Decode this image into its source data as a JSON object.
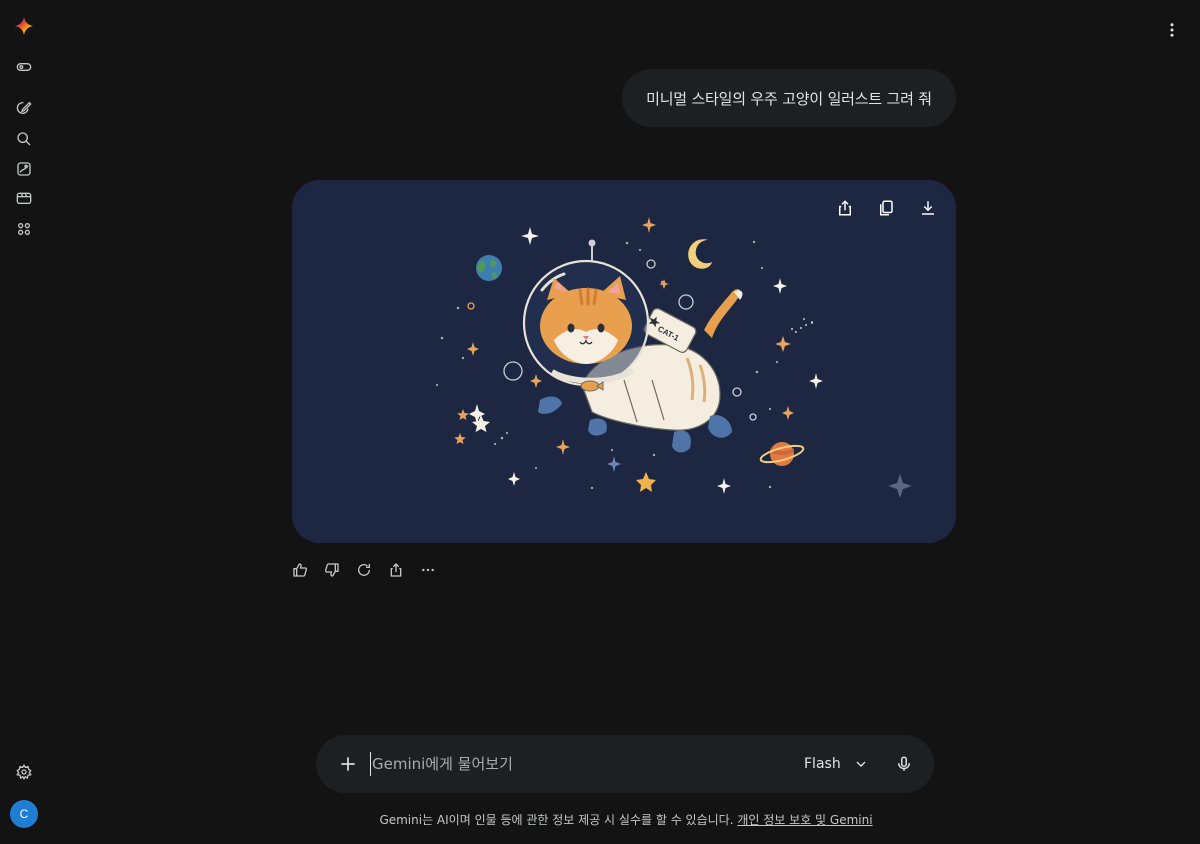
{
  "app": {
    "name": "Gemini",
    "accent_colors": [
      "#4285f4",
      "#ea4335",
      "#fbbc04",
      "#34a853"
    ]
  },
  "sidebar": {
    "items": [
      {
        "icon": "gemini-logo-icon"
      },
      {
        "icon": "toggle-sidebar-icon"
      },
      {
        "icon": "new-chat-icon"
      },
      {
        "icon": "search-icon"
      },
      {
        "icon": "gallery-icon"
      },
      {
        "icon": "video-icon"
      },
      {
        "icon": "apps-grid-icon"
      }
    ],
    "settings_icon": "gear-icon",
    "avatar_initial": "C",
    "avatar_color": "#1f7ed4"
  },
  "conversation": {
    "user_message": "미니멀 스타일의 우주 고양이 일러스트 그려 줘",
    "image_badge": "CAT-1",
    "image_actions": [
      "share-icon",
      "copy-icon",
      "download-icon"
    ],
    "reply_actions": [
      "thumbs-up-icon",
      "thumbs-down-icon",
      "regenerate-icon",
      "share-icon",
      "more-icon"
    ]
  },
  "composer": {
    "placeholder": "Gemini에게 물어보기",
    "model": "Flash"
  },
  "footer": {
    "disclaimer": "Gemini는 AI이며 인물 등에 관한 정보 제공 시 실수를 할 수 있습니다.",
    "privacy_link": "개인 정보 보호 및 Gemini"
  }
}
